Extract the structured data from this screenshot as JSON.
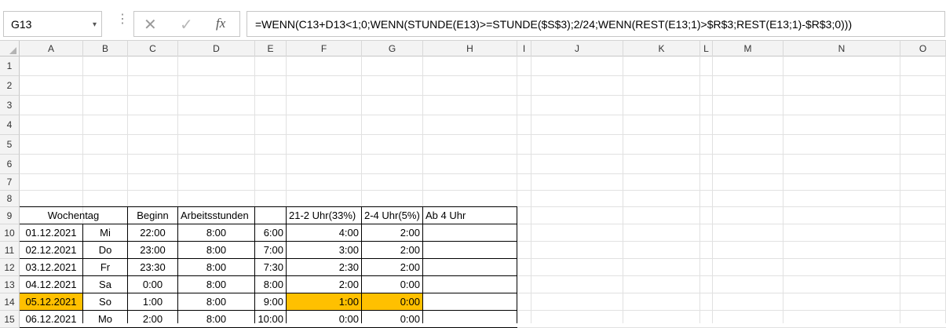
{
  "name_box": {
    "value": "G13",
    "arrow": "▾"
  },
  "formula_bar": {
    "more": "⋮",
    "cancel_glyph": "✕",
    "enter_glyph": "✓",
    "fx_label": "fx",
    "formula": "=WENN(C13+D13<1;0;WENN(STUNDE(E13)>=STUNDE($S$3);2/24;WENN(REST(E13;1)>$R$3;REST(E13;1)-$R$3;0)))"
  },
  "columns": [
    "A",
    "B",
    "C",
    "D",
    "E",
    "F",
    "G",
    "H",
    "I",
    "J",
    "K",
    "L",
    "M",
    "N",
    "O"
  ],
  "rows": [
    "1",
    "2",
    "3",
    "4",
    "5",
    "6",
    "7",
    "8",
    "9",
    "10",
    "11",
    "12",
    "13",
    "14",
    "15"
  ],
  "headers": {
    "wochentag": "Wochentag",
    "beginn": "Beginn",
    "arbeitsstunden": "Arbeitsstunden",
    "f": "21-2 Uhr(33%)",
    "g": "2-4 Uhr(5%)",
    "h": "Ab 4 Uhr"
  },
  "data": [
    {
      "date": "01.12.2021",
      "day": "Mi",
      "beginn": "22:00",
      "stunden": "8:00",
      "e": "6:00",
      "f": "4:00",
      "g": "2:00"
    },
    {
      "date": "02.12.2021",
      "day": "Do",
      "beginn": "23:00",
      "stunden": "8:00",
      "e": "7:00",
      "f": "3:00",
      "g": "2:00"
    },
    {
      "date": "03.12.2021",
      "day": "Fr",
      "beginn": "23:30",
      "stunden": "8:00",
      "e": "7:30",
      "f": "2:30",
      "g": "2:00"
    },
    {
      "date": "04.12.2021",
      "day": "Sa",
      "beginn": "0:00",
      "stunden": "8:00",
      "e": "8:00",
      "f": "2:00",
      "g": "0:00"
    },
    {
      "date": "05.12.2021",
      "day": "So",
      "beginn": "1:00",
      "stunden": "8:00",
      "e": "9:00",
      "f": "1:00",
      "g": "0:00"
    },
    {
      "date": "06.12.2021",
      "day": "Mo",
      "beginn": "2:00",
      "stunden": "8:00",
      "e": "10:00",
      "f": "0:00",
      "g": "0:00"
    }
  ],
  "colors": {
    "highlight": "#ffc000",
    "grid": "#e1e1e1",
    "header_bg": "#f3f3f3"
  }
}
